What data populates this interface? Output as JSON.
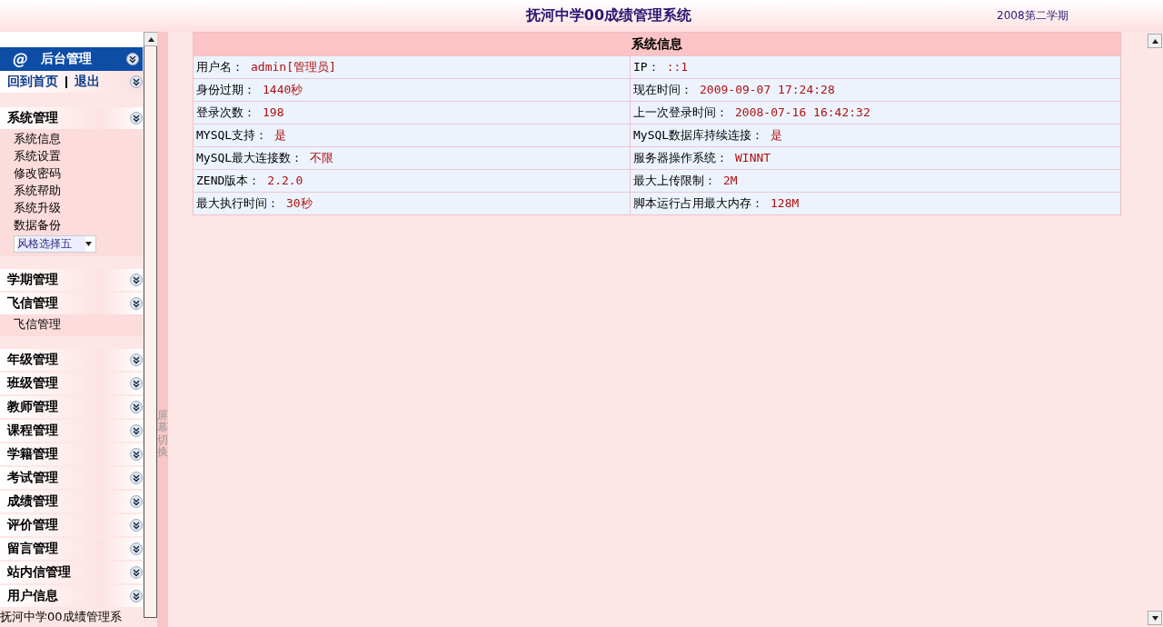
{
  "header": {
    "title": "抚河中学00成绩管理系统",
    "term": "2008第二学期"
  },
  "sidebar": {
    "header": {
      "icon_char": "@",
      "label": "后台管理"
    },
    "links": [
      {
        "label": "回到首页"
      },
      {
        "label": "退出"
      }
    ],
    "groups": [
      {
        "label": "系统管理",
        "children": [
          {
            "label": "系统信息"
          },
          {
            "label": "系统设置"
          },
          {
            "label": "修改密码"
          },
          {
            "label": "系统帮助"
          },
          {
            "label": "系统升级"
          },
          {
            "label": "数据备份"
          }
        ],
        "style_select": {
          "value": "风格选择五"
        }
      },
      {
        "label": "学期管理",
        "gap": true
      },
      {
        "label": "飞信管理",
        "children": [
          {
            "label": "飞信管理"
          }
        ]
      },
      {
        "label": "年级管理",
        "gap": true
      },
      {
        "label": "班级管理"
      },
      {
        "label": "教师管理"
      },
      {
        "label": "课程管理"
      },
      {
        "label": "学籍管理"
      },
      {
        "label": "考试管理"
      },
      {
        "label": "成绩管理"
      },
      {
        "label": "评价管理"
      },
      {
        "label": "留言管理"
      },
      {
        "label": "站内信管理"
      },
      {
        "label": "用户信息"
      }
    ],
    "footer": "抚河中学00成绩管理系"
  },
  "splitter": {
    "label": "屏幕切换"
  },
  "info_table": {
    "title": "系统信息",
    "rows": [
      [
        {
          "label": "用户名：",
          "value": "admin[管理员]"
        },
        {
          "label": "IP：",
          "value": "::1"
        }
      ],
      [
        {
          "label": "身份过期：",
          "value": "1440秒"
        },
        {
          "label": "现在时间：",
          "value": "2009-09-07 17:24:28"
        }
      ],
      [
        {
          "label": "登录次数：",
          "value": "198"
        },
        {
          "label": "上一次登录时间：",
          "value": "2008-07-16 16:42:32"
        }
      ],
      [
        {
          "label": "MYSQL支持：",
          "value": "是"
        },
        {
          "label": "MySQL数据库持续连接：",
          "value": "是"
        }
      ],
      [
        {
          "label": "MySQL最大连接数：",
          "value": "不限"
        },
        {
          "label": "服务器操作系统：",
          "value": "WINNT"
        }
      ],
      [
        {
          "label": "ZEND版本：",
          "value": "2.2.0"
        },
        {
          "label": "最大上传限制：",
          "value": "2M"
        }
      ],
      [
        {
          "label": "最大执行时间：",
          "value": "30秒"
        },
        {
          "label": "脚本运行占用最大内存：",
          "value": "128M"
        }
      ]
    ]
  }
}
